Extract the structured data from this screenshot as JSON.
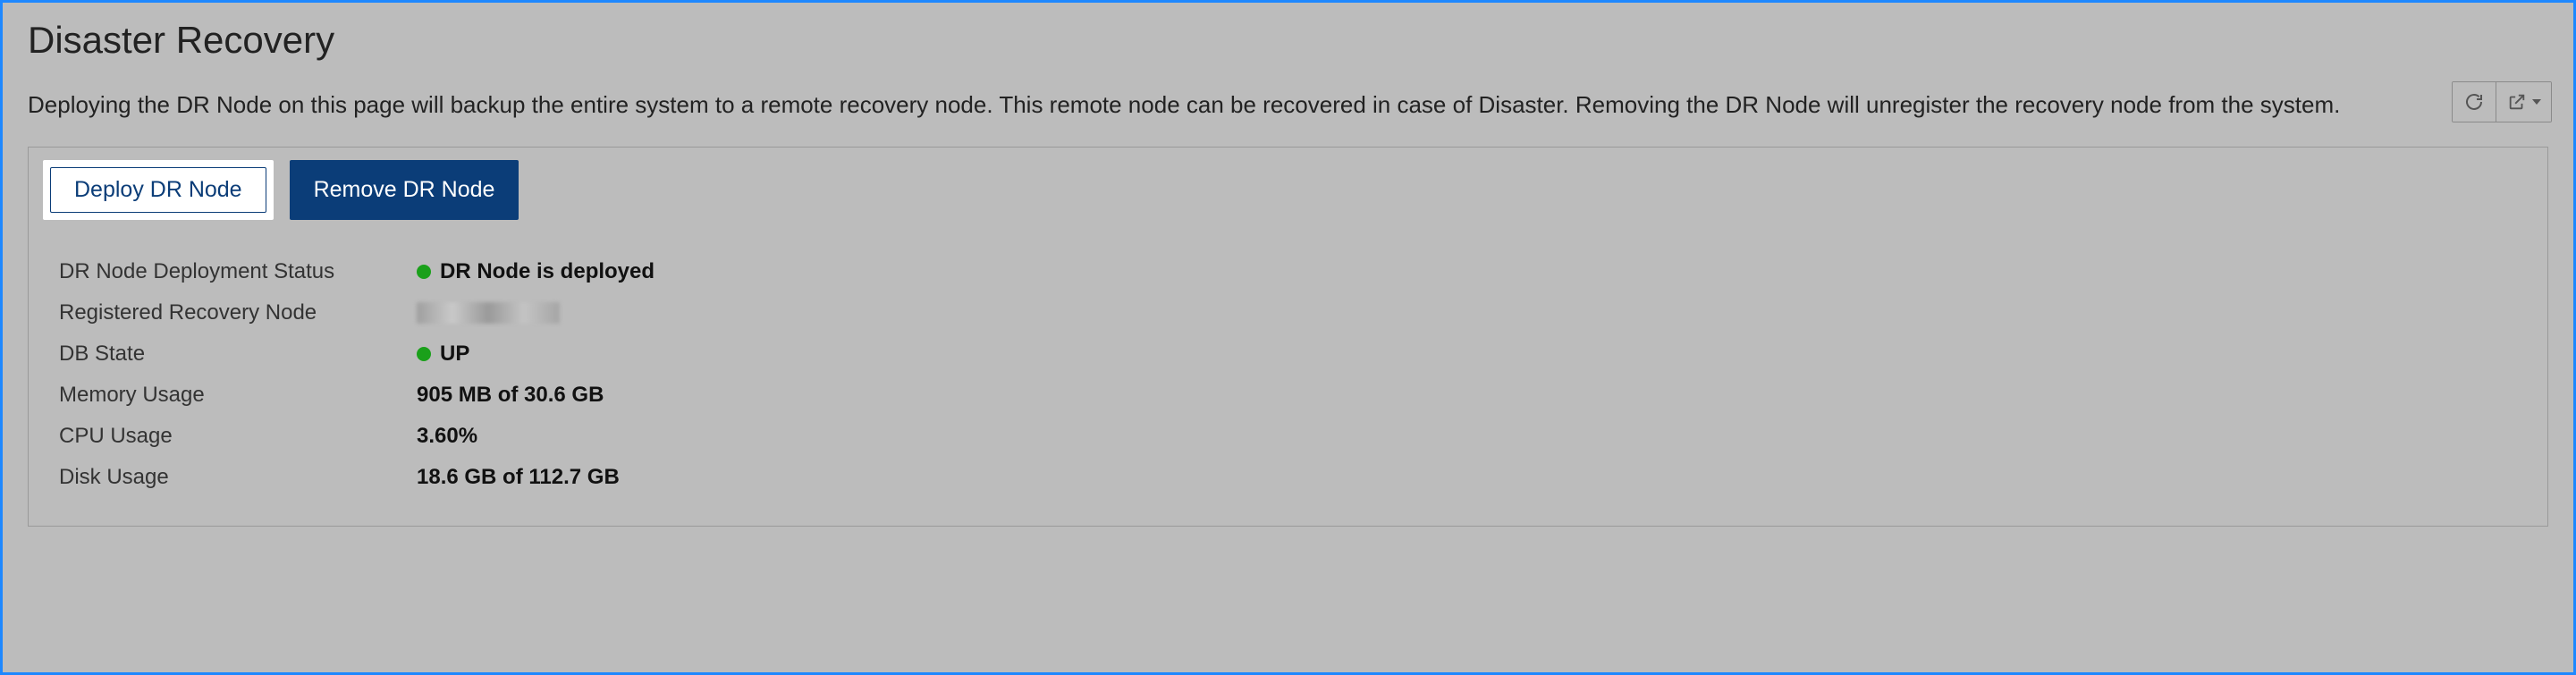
{
  "header": {
    "title": "Disaster Recovery",
    "description": "Deploying the DR Node on this page will backup the entire system to a remote recovery node. This remote node can be recovered in case of Disaster. Removing the DR Node will unregister the recovery node from the system."
  },
  "actions": {
    "deploy_label": "Deploy DR Node",
    "remove_label": "Remove DR Node"
  },
  "status": {
    "deployment_label": "DR Node Deployment Status",
    "deployment_value": "DR Node is deployed",
    "deployment_color": "#1aa01a",
    "recovery_node_label": "Registered Recovery Node",
    "recovery_node_value": "",
    "db_state_label": "DB State",
    "db_state_value": "UP",
    "db_state_color": "#1aa01a",
    "memory_label": "Memory Usage",
    "memory_value": "905 MB of 30.6 GB",
    "cpu_label": "CPU Usage",
    "cpu_value": "3.60%",
    "disk_label": "Disk Usage",
    "disk_value": "18.6 GB of 112.7 GB"
  }
}
